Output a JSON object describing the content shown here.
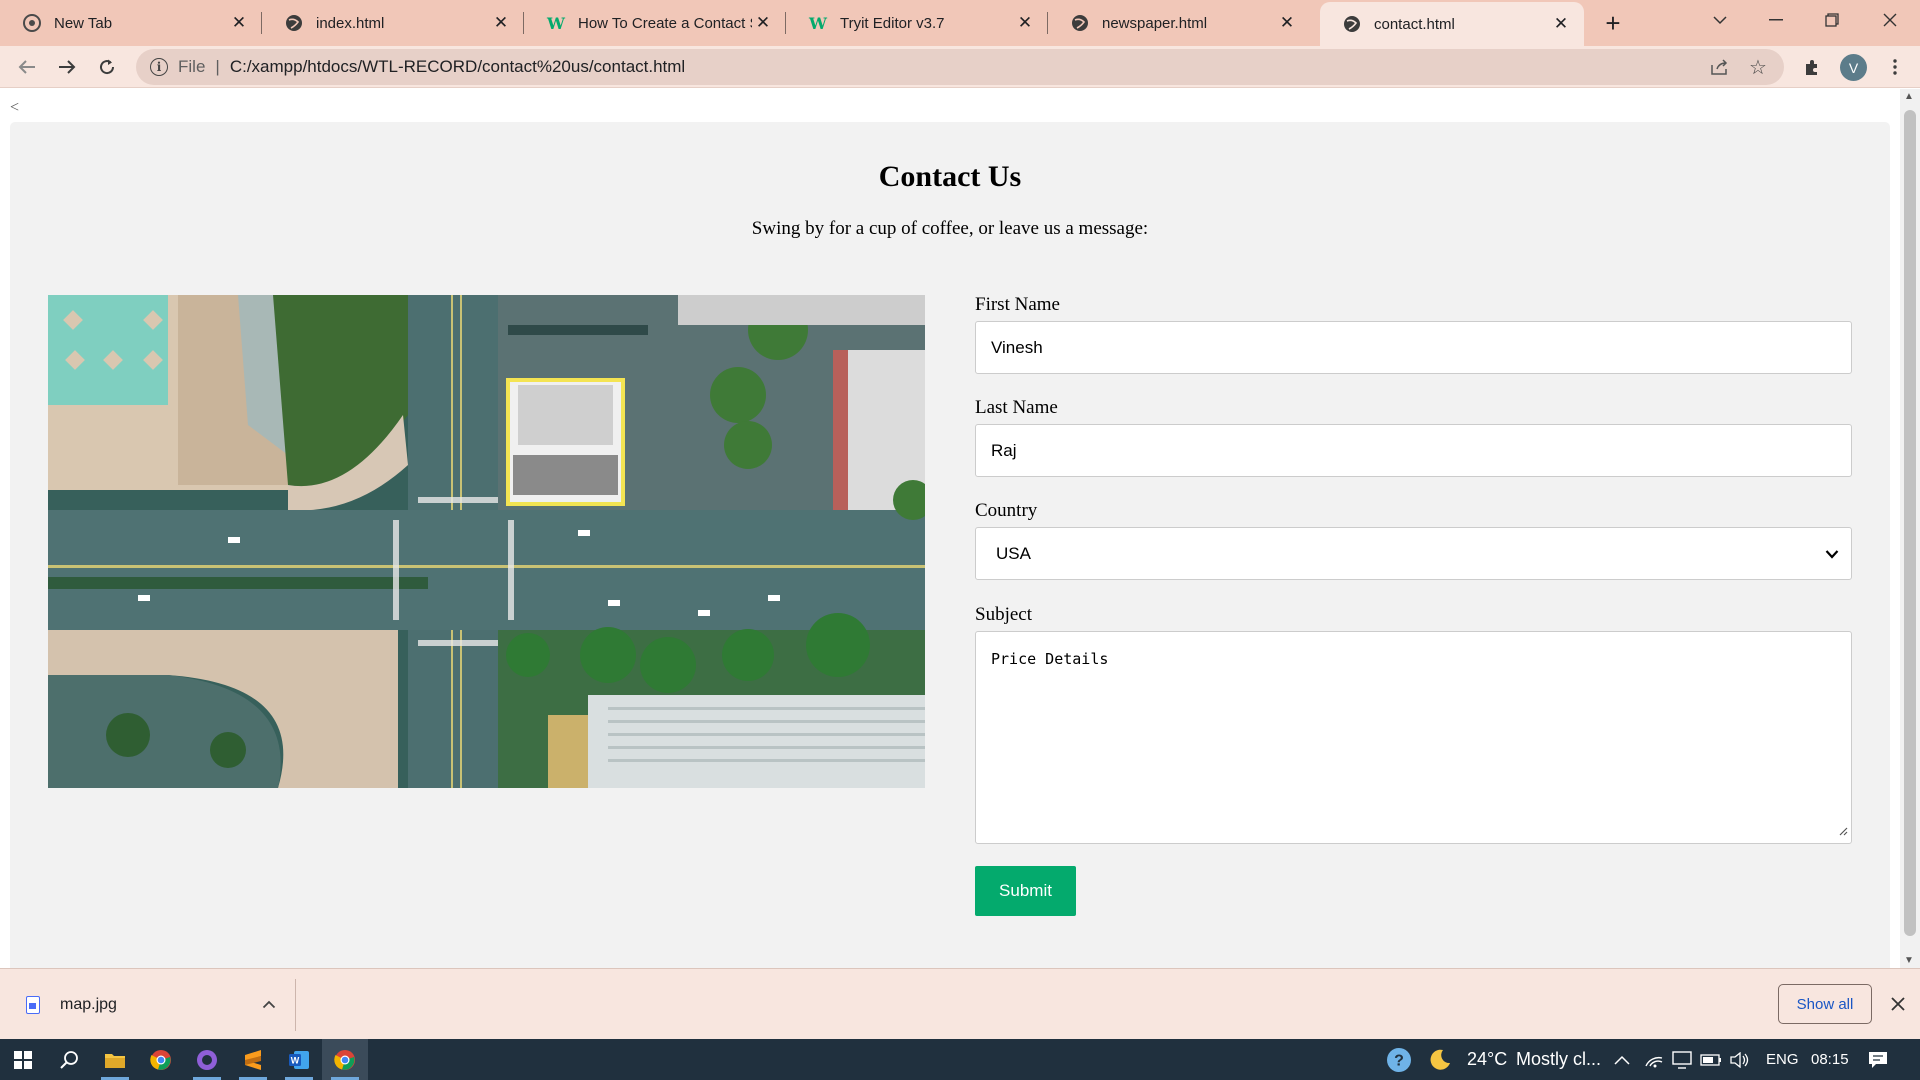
{
  "browser": {
    "tabs": [
      {
        "title": "New Tab",
        "favicon": "chrome-icon",
        "active": false
      },
      {
        "title": "index.html",
        "favicon": "globe-icon",
        "active": false
      },
      {
        "title": "How To Create a Contact Se",
        "favicon": "w3schools-icon",
        "active": false
      },
      {
        "title": "Tryit Editor v3.7",
        "favicon": "w3schools-icon",
        "active": false
      },
      {
        "title": "newspaper.html",
        "favicon": "globe-icon",
        "active": false
      },
      {
        "title": "contact.html",
        "favicon": "globe-icon",
        "active": true
      }
    ],
    "address": {
      "scheme": "File",
      "url": "C:/xampp/htdocs/WTL-RECORD/contact%20us/contact.html"
    },
    "profile_initial": "V"
  },
  "page": {
    "back_link": "<",
    "heading": "Contact Us",
    "tagline": "Swing by for a cup of coffee, or leave us a message:",
    "image_alt": "aerial city map",
    "form": {
      "first_name_label": "First Name",
      "first_name_value": "Vinesh",
      "last_name_label": "Last Name",
      "last_name_value": "Raj",
      "country_label": "Country",
      "country_value": "USA",
      "subject_label": "Subject",
      "subject_value": "Price Details",
      "submit_label": "Submit"
    }
  },
  "downloads": {
    "file_name": "map.jpg",
    "show_all_label": "Show all"
  },
  "taskbar": {
    "weather_temp": "24°C",
    "weather_desc": "Mostly cl...",
    "language": "ENG",
    "time": "08:15"
  },
  "colors": {
    "tabstrip_bg": "#f1c7b8",
    "toolbar_bg": "#f8e6df",
    "submit_green": "#04aa6d",
    "taskbar_bg": "#20303e"
  }
}
